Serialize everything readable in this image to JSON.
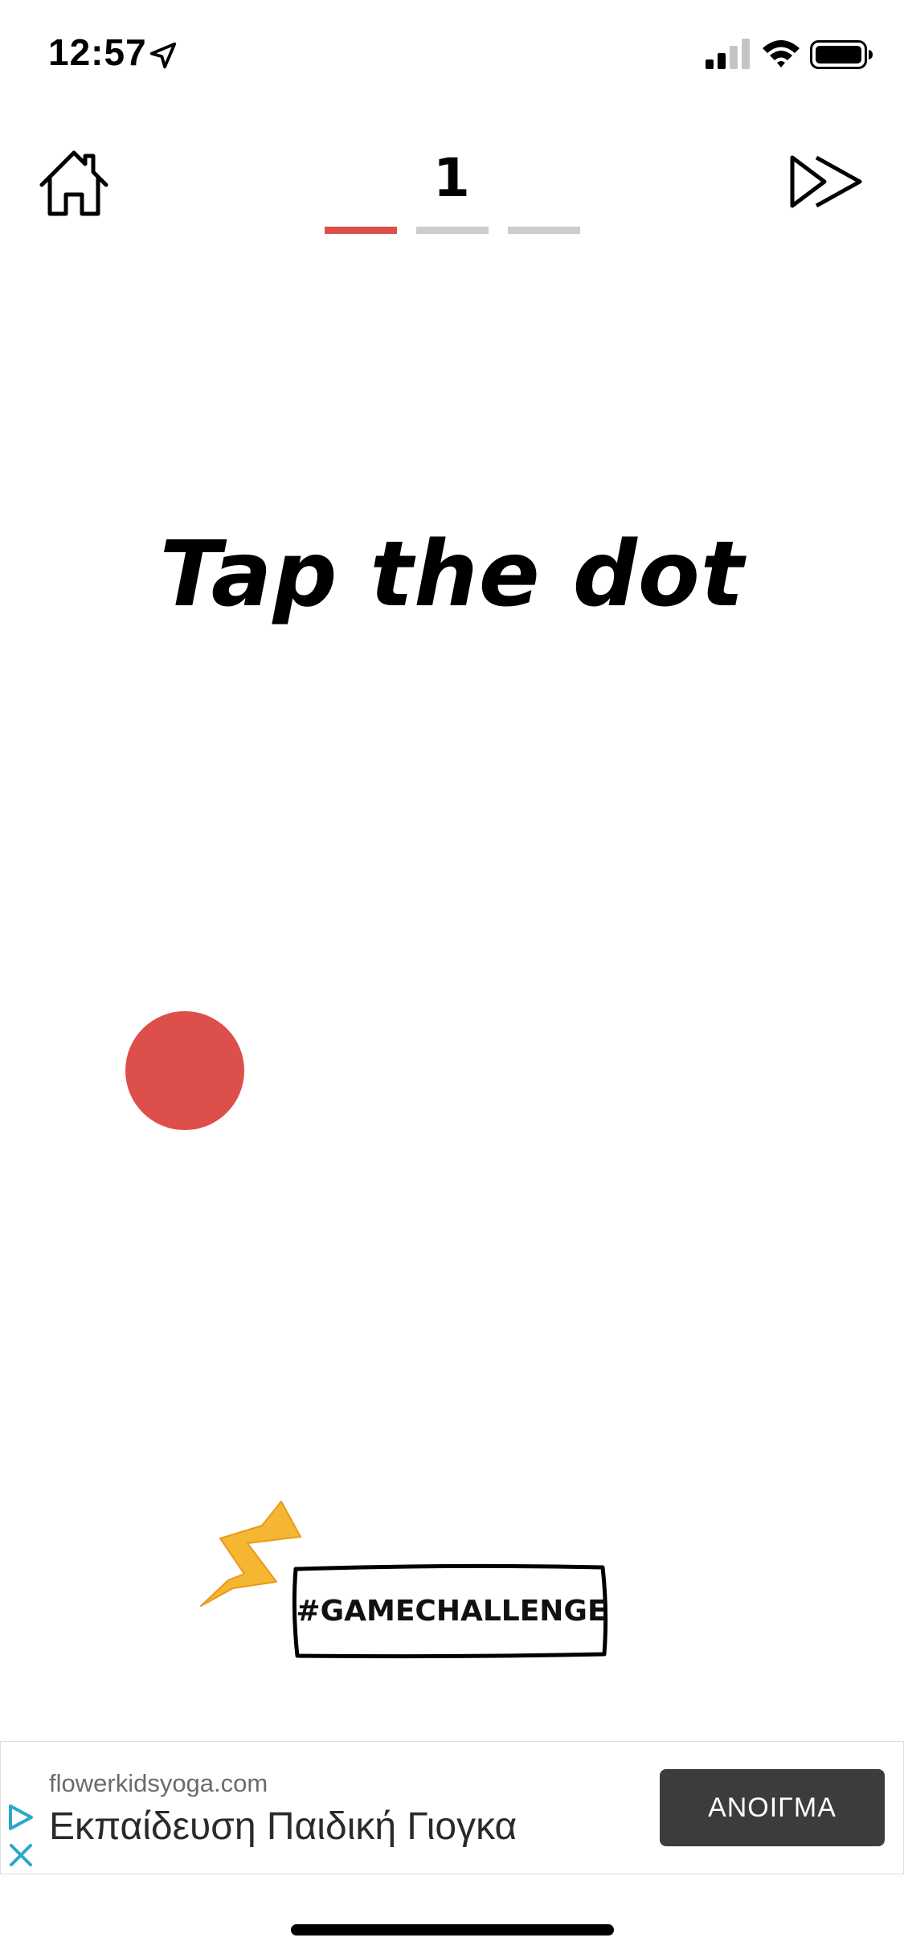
{
  "status_bar": {
    "time": "12:57",
    "icons": [
      "location-arrow-icon",
      "cellular-signal-icon",
      "wifi-icon",
      "battery-icon"
    ]
  },
  "top_nav": {
    "home_icon": "home-icon",
    "skip_icon": "fast-forward-icon",
    "level": "1",
    "progress": {
      "total": 3,
      "completed": 1,
      "active_color": "#dd4f4b",
      "inactive_color": "#cccccc"
    }
  },
  "game": {
    "instruction": "Tap the dot",
    "dot_color": "#dd4f4b"
  },
  "badge": {
    "text": "#GAMECHALLENGE",
    "lightning_color": "#f5b731"
  },
  "ad": {
    "domain": "flowerkidsyoga.com",
    "headline": "Εκπαίδευση Παιδική Γιογκα",
    "button_label": "ΑΝΟΙΓΜΑ",
    "button_color": "#3c3c3c",
    "icons": [
      "ad-choices-icon",
      "close-icon"
    ]
  }
}
